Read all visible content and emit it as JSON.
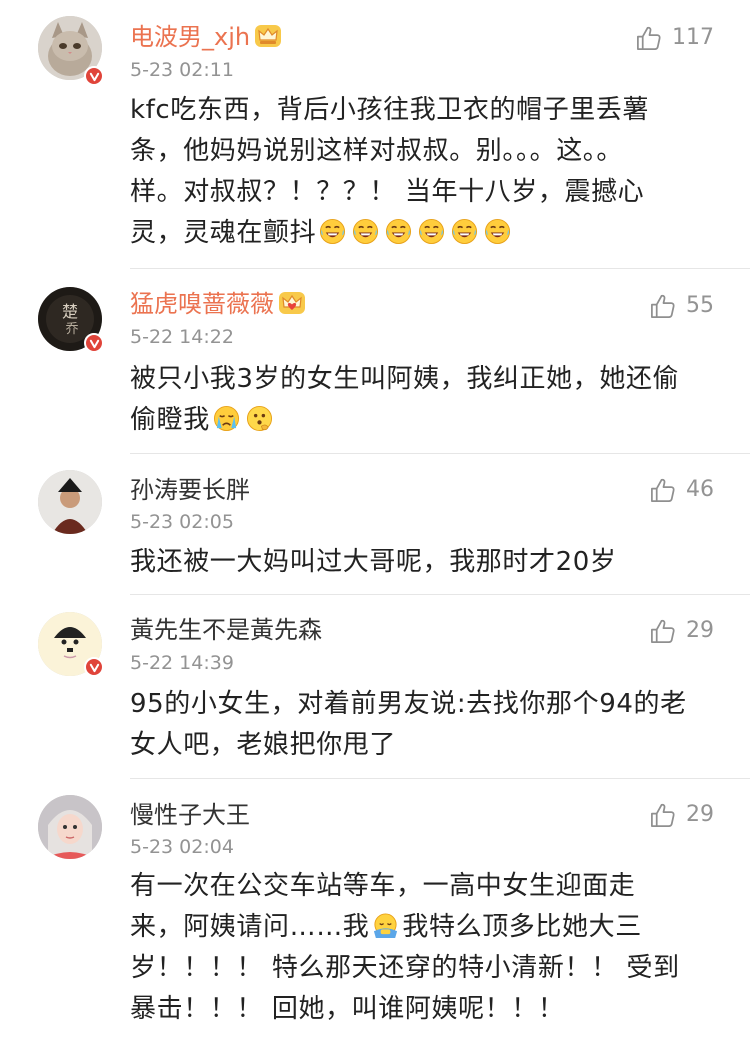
{
  "comments": [
    {
      "username": "电波男_xjh",
      "time": "5-23 02:11",
      "likes": "117",
      "vip": true,
      "text_lines": [
        "kfc吃东西，背后小孩往我卫衣的帽子里丢薯",
        "条，他妈妈说别这样对叔叔。别。。。这。。",
        "样。对叔叔？！？？！ 当年十八岁，震撼心",
        "灵，灵魂在颤抖"
      ],
      "emoji": [
        "laugh-cry",
        "laugh-cry",
        "laugh-cry",
        "laugh-cry",
        "laugh-cry",
        "laugh-cry"
      ]
    },
    {
      "username": "猛虎嗅蔷薇薇",
      "time": "5-22 14:22",
      "likes": "55",
      "vip": true,
      "text_lines": [
        "被只小我3岁的女生叫阿姨，我纠正她，她还偷",
        "偷瞪我"
      ],
      "emoji": [
        "cry",
        "think"
      ]
    },
    {
      "username": "孙涛要长胖",
      "time": "5-23 02:05",
      "likes": "46",
      "vip": false,
      "text_lines": [
        "我还被一大妈叫过大哥呢，我那时才20岁"
      ]
    },
    {
      "username": "黃先生不是黃先森",
      "time": "5-22 14:39",
      "likes": "29",
      "vip": false,
      "text_lines": [
        "95的小女生，对着前男友说:去找你那个94的老",
        "女人吧，老娘把你甩了"
      ]
    },
    {
      "username": "慢性子大王",
      "time": "5-23 02:04",
      "likes": "29",
      "vip": false,
      "text_lines": [
        "有一次在公交车站等车，一高中女生迎面走",
        "来，阿姨请问……我",
        "我特么顶多比她大三",
        "岁！！！！ 特么那天还穿的特小清新！！ 受到",
        "暴击！！！ 回她，叫谁阿姨呢！！！"
      ],
      "emoji": [
        "facepalm"
      ]
    }
  ],
  "colors": {
    "vip_name": "#eb7350",
    "meta": "#939393",
    "badge": "#e0443a",
    "divider": "#e6e6e6"
  }
}
